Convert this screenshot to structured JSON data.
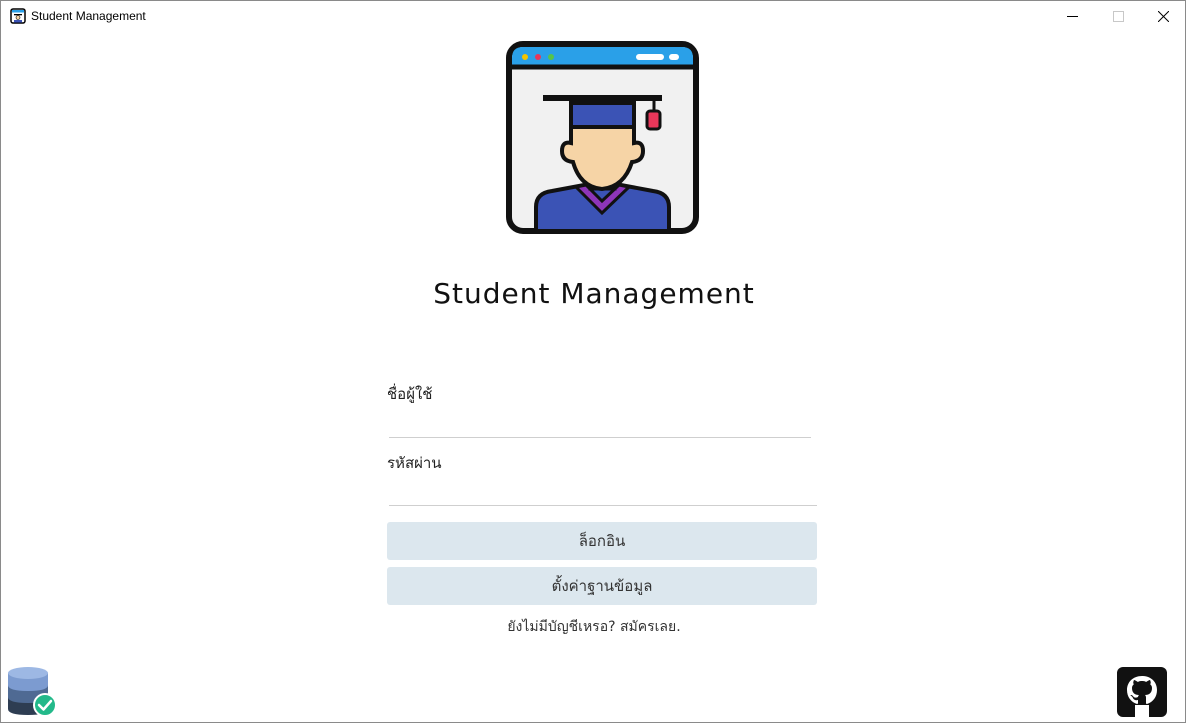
{
  "window": {
    "title": "Student Management"
  },
  "app": {
    "heading": "Student Management"
  },
  "form": {
    "username_label": "ชื่อผู้ใช้",
    "username_value": "",
    "password_label": "รหัสผ่าน",
    "password_value": "",
    "login_label": "ล็อกอิน",
    "db_settings_label": "ตั้งค่าฐานข้อมูล",
    "signup_text": "ยังไม่มีบัญชีเหรอ? สมัครเลย."
  },
  "colors": {
    "button_bg": "#dce7ee",
    "logo_bar": "#2aa0e8",
    "cap": "#3b53b5",
    "gown": "#3b53b5",
    "collar": "#8d35b8",
    "db_ok": "#23b98a"
  },
  "icons": {
    "app": "student-app-icon",
    "database": "database-connected-icon",
    "github": "github-icon"
  }
}
